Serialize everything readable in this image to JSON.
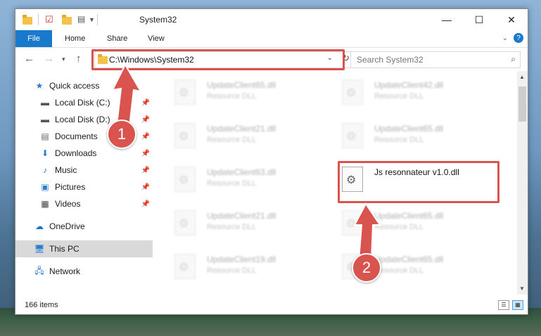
{
  "window": {
    "title": "System32",
    "controls": {
      "minimize": "—",
      "maximize": "☐",
      "close": "✕"
    }
  },
  "ribbon": {
    "tabs": [
      "File",
      "Home",
      "Share",
      "View"
    ]
  },
  "toolbar": {
    "address": "C:\\Windows\\System32",
    "search_placeholder": "Search System32"
  },
  "nav": {
    "items": [
      {
        "label": "Quick access",
        "icon": "star-icon",
        "pinned": false
      },
      {
        "label": "Local Disk (C:)",
        "icon": "drive-icon",
        "pinned": true
      },
      {
        "label": "Local Disk (D:)",
        "icon": "drive-icon",
        "pinned": true
      },
      {
        "label": "Documents",
        "icon": "documents-icon",
        "pinned": true
      },
      {
        "label": "Downloads",
        "icon": "downloads-icon",
        "pinned": true
      },
      {
        "label": "Music",
        "icon": "music-icon",
        "pinned": true
      },
      {
        "label": "Pictures",
        "icon": "pictures-icon",
        "pinned": true
      },
      {
        "label": "Videos",
        "icon": "videos-icon",
        "pinned": true
      },
      {
        "label": "OneDrive",
        "icon": "onedrive-icon",
        "pinned": false
      },
      {
        "label": "This PC",
        "icon": "thispc-icon",
        "pinned": false,
        "selected": true
      },
      {
        "label": "Network",
        "icon": "network-icon",
        "pinned": false
      }
    ]
  },
  "files": [
    {
      "name": "UpdateClient65.dll",
      "type": "Resource DLL"
    },
    {
      "name": "UpdateClient42.dll",
      "type": "Resource DLL"
    },
    {
      "name": "UpdateClient21.dll",
      "type": "Resource DLL"
    },
    {
      "name": "UpdateClient65.dll",
      "type": "Resource DLL"
    },
    {
      "name": "UpdateClient63.dll",
      "type": "Resource DLL"
    },
    {
      "name": "Js resonnateur v1.0.dll",
      "type": "",
      "highlighted": true
    },
    {
      "name": "UpdateClient21.dll",
      "type": "Resource DLL"
    },
    {
      "name": "UpdateClient65.dll",
      "type": "Resource DLL"
    },
    {
      "name": "UpdateClient19.dll",
      "type": "Resource DLL"
    },
    {
      "name": "UpdateClient65.dll",
      "type": "Resource DLL"
    }
  ],
  "status": {
    "item_count": "166 items"
  },
  "callouts": [
    "1",
    "2"
  ],
  "colors": {
    "accent": "#1979ca",
    "highlight": "#d9534f",
    "selected_nav": "#d9d9d9"
  }
}
